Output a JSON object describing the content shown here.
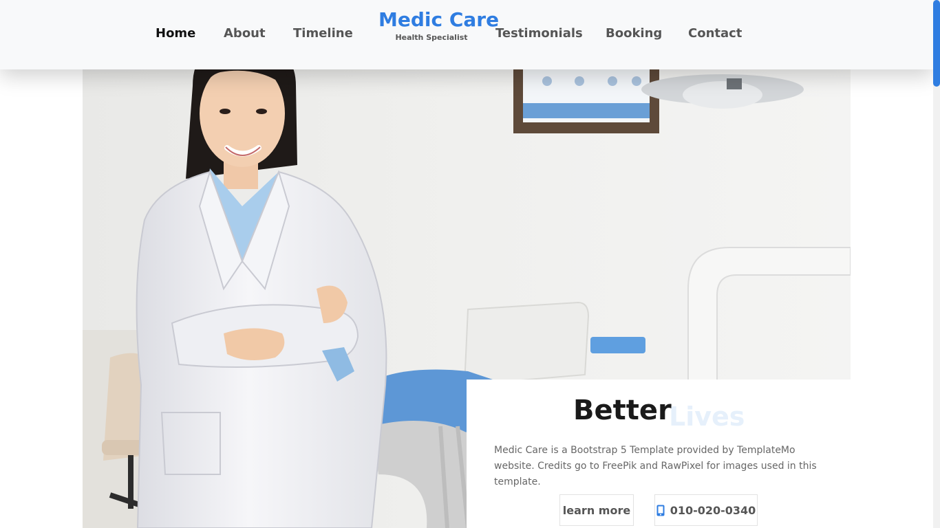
{
  "nav": {
    "items": [
      {
        "label": "Home",
        "active": true
      },
      {
        "label": "About"
      },
      {
        "label": "Timeline"
      },
      {
        "label": "Testimonials"
      },
      {
        "label": "Booking"
      },
      {
        "label": "Contact"
      }
    ],
    "brand": {
      "name": "Medic Care",
      "tagline": "Health Specialist"
    }
  },
  "hero": {
    "image": "smiling-doctor-in-clinic",
    "headline": "Better",
    "headline_ghost": "Lives",
    "description": "Medic Care is a Bootstrap 5 Template provided by TemplateMo website. Credits go to FreePik and RawPixel for images used in this template.",
    "buttons": {
      "learn_more": "learn more",
      "phone": "010-020-0340",
      "phone_icon": "phone-icon"
    }
  },
  "colors": {
    "brand": "#2f7de1",
    "nav_bg": "#f8f9fa",
    "text_dark": "#1a1a1a",
    "text_muted": "#555555"
  }
}
